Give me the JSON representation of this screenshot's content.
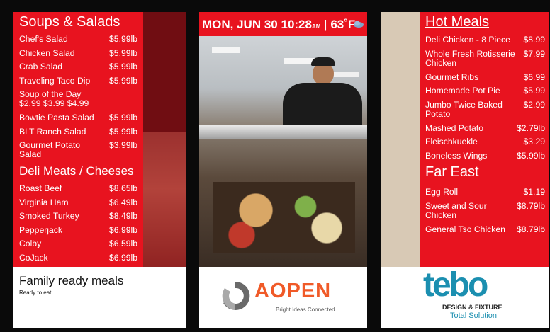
{
  "colors": {
    "brand_red": "#e8131f",
    "aopen_orange": "#f05a28",
    "tebo_blue": "#1b8fb0"
  },
  "left_panel": {
    "soups_title": "Soups & Salads",
    "soups": [
      {
        "name": "Chef's Salad",
        "price": "$5.99lb"
      },
      {
        "name": "Chicken Salad",
        "price": "$5.99lb"
      },
      {
        "name": "Crab Salad",
        "price": "$5.99lb"
      },
      {
        "name": "Traveling Taco Dip",
        "price": "$5.99lb"
      },
      {
        "name": "Soup of the Day",
        "price": "",
        "sub": "$2.99 $3.99 $4.99"
      },
      {
        "name": "Bowtie Pasta Salad",
        "price": "$5.99lb"
      },
      {
        "name": "BLT Ranch Salad",
        "price": "$5.99lb"
      },
      {
        "name": "Gourmet Potato",
        "name2": "Salad",
        "price": "$3.99lb"
      }
    ],
    "deli_title": "Deli Meats / Cheeses",
    "deli": [
      {
        "name": "Roast Beef",
        "price": "$8.65lb"
      },
      {
        "name": "Virginia Ham",
        "price": "$6.49lb"
      },
      {
        "name": "Smoked Turkey",
        "price": "$8.49lb"
      },
      {
        "name": "Pepperjack",
        "price": "$6.99lb"
      },
      {
        "name": "Colby",
        "price": "$6.59lb"
      },
      {
        "name": "CoJack",
        "price": "$6.99lb"
      }
    ],
    "footer_title": "Family ready meals",
    "footer_sub": "Ready to eat"
  },
  "middle_panel": {
    "date": "MON, JUN 30",
    "time": "10:28",
    "ampm": "AM",
    "temperature": "63˚F",
    "weather_icon": "cloud-icon",
    "brand": "AOPEN",
    "tagline": "Bright Ideas Connected"
  },
  "right_panel": {
    "hot_title": "Hot Meals",
    "hot": [
      {
        "name": "Deli Chicken - 8 Piece",
        "price": "$8.99"
      },
      {
        "name": "Whole Fresh Rotisserie",
        "name2": "Chicken",
        "price": "$7.99"
      },
      {
        "name": "Gourmet Ribs",
        "price": "$6.99"
      },
      {
        "name": "Homemade Pot Pie",
        "price": "$5.99"
      },
      {
        "name": "Jumbo Twice Baked",
        "name2": "Potato",
        "price": "$2.99"
      },
      {
        "name": "Mashed Potato",
        "price": "$2.79lb"
      },
      {
        "name": "Fleischkuekle",
        "price": "$3.29"
      },
      {
        "name": "Boneless Wings",
        "price": "$5.99lb"
      }
    ],
    "far_east_title": "Far East",
    "far_east": [
      {
        "name": "Egg Roll",
        "price": "$1.19"
      },
      {
        "name": "Sweet and Sour",
        "name2": "Chicken",
        "price": "$8.79lb"
      },
      {
        "name": "General Tso Chicken",
        "price": "$8.79lb"
      }
    ],
    "logo_name": "tebo",
    "logo_line1": "DESIGN & FIXTURE",
    "logo_line2": "Total Solution"
  }
}
